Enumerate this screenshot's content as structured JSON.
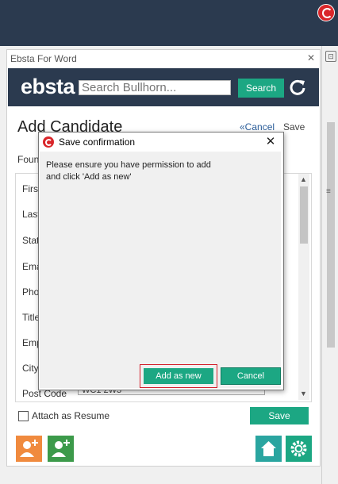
{
  "window": {
    "title": "Ebsta For Word"
  },
  "ebsta": {
    "brand": "ebsta",
    "search_placeholder": "Search Bullhorn...",
    "search_button": "Search"
  },
  "form": {
    "title": "Add Candidate",
    "cancel_link": "«Cancel",
    "save_link": "Save",
    "found_label": "Foun",
    "fields": [
      {
        "label": "First"
      },
      {
        "label": "Last"
      },
      {
        "label": "Stat"
      },
      {
        "label": "Ema"
      },
      {
        "label": "Pho"
      },
      {
        "label": "Title"
      },
      {
        "label": "Emp"
      },
      {
        "label": "City"
      },
      {
        "label": "Post Code",
        "value": "WC1 2W3"
      }
    ],
    "attach_label": "Attach as Resume",
    "save_button": "Save"
  },
  "dialog": {
    "title": "Save confirmation",
    "message": "Please ensure you have permission to add\nand click 'Add as new'",
    "add_button": "Add as new",
    "cancel_button": "Cancel"
  },
  "toolbar": {
    "icons": [
      "add-candidate-icon",
      "add-contact-icon",
      "home-icon",
      "settings-icon"
    ]
  },
  "colors": {
    "header": "#2b3a4f",
    "accent": "#1ca783",
    "highlight": "#d21f2a"
  }
}
